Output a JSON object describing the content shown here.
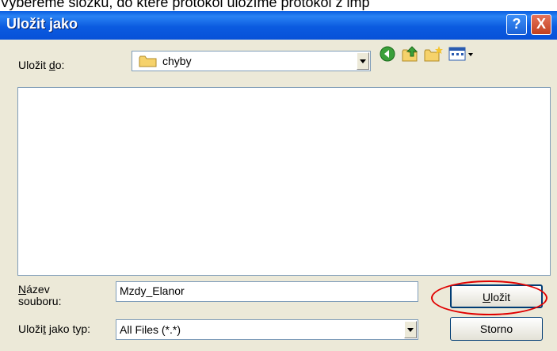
{
  "caption": "Vybereme složku, do které protokol uložíme protokol z imp",
  "window": {
    "title": "Uložit jako",
    "help_glyph": "?",
    "close_glyph": "X"
  },
  "toolbar": {
    "save_in_label_pre": "Uložit ",
    "save_in_label_key": "d",
    "save_in_label_post": "o:",
    "current_folder": "chyby"
  },
  "form": {
    "filename_label_key": "N",
    "filename_label_rest": "ázev",
    "filename_label_line2": "souboru:",
    "filename_value": "Mzdy_Elanor",
    "type_label_pre": "Uloži",
    "type_label_key": "t",
    "type_label_post": " jako typ:",
    "type_value": "All Files (*.*)"
  },
  "buttons": {
    "save_key": "U",
    "save_rest": "ložit",
    "cancel": "Storno"
  },
  "colors": {
    "title_bar": "#0a5ee0",
    "dialog_bg": "#ece9d8",
    "highlight_circle": "#e00000"
  }
}
